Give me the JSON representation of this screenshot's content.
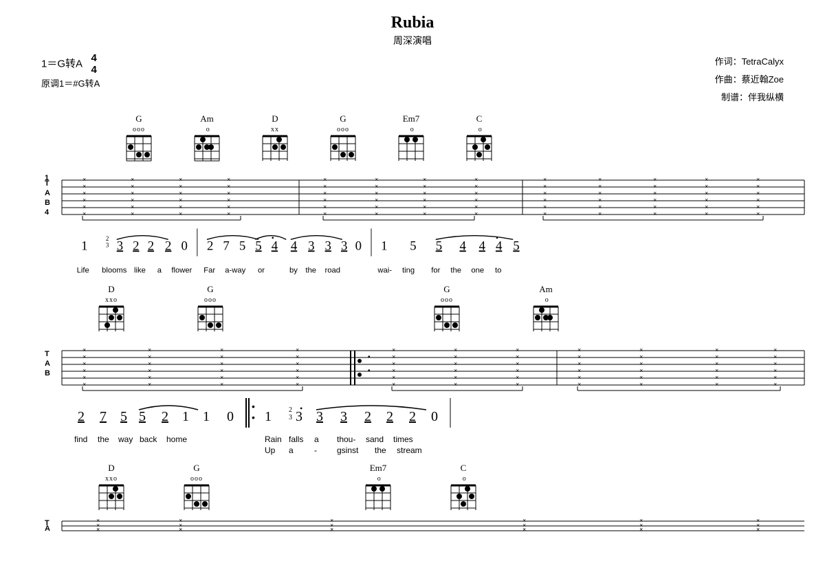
{
  "title": "Rubia",
  "singer": "周深演唱",
  "key": "1＝G转A",
  "time_sig_num": "4",
  "time_sig_den": "4",
  "original_key": "原调1＝#G转A",
  "author_lyrics": "作词：TetraCalyx",
  "author_music": "作曲：蔡近翰Zoe",
  "author_tab": "制谱：伴我纵横",
  "chords_row1": [
    {
      "name": "G",
      "markers": "ooo"
    },
    {
      "name": "Am",
      "markers": "o"
    },
    {
      "name": "D",
      "markers": "xx"
    },
    {
      "name": "G",
      "markers": "ooo"
    },
    {
      "name": "Em7",
      "markers": "o"
    },
    {
      "name": "C",
      "markers": "o"
    }
  ],
  "chords_row2": [
    {
      "name": "D",
      "markers": "xxo"
    },
    {
      "name": "G",
      "markers": "ooo"
    },
    {
      "name": "G",
      "markers": "ooo"
    },
    {
      "name": "Am",
      "markers": "o"
    }
  ],
  "chords_row3": [
    {
      "name": "D",
      "markers": "xxo"
    },
    {
      "name": "G",
      "markers": "ooo"
    },
    {
      "name": "Em7",
      "markers": "o"
    },
    {
      "name": "C",
      "markers": "o"
    }
  ],
  "notation_line1": "1  ²₃  3 2 2  2 0 | 2 7 5  5 4• 4 3 3  3 0 | 1  5  5 4 4 4• 5",
  "lyrics_line1": "Life blooms like a flower    Far a-way or by the road    wai-ting for the one  to",
  "notation_line2": "2  7 5  5  2 1  1  0 |: 1  ²3•  3  3 2 2  2 0",
  "lyrics_line2": "find  the way  back home     Rain falls  a thou-sand times",
  "lyrics_line2b": "Up  a  -  gsinst  the  stream"
}
